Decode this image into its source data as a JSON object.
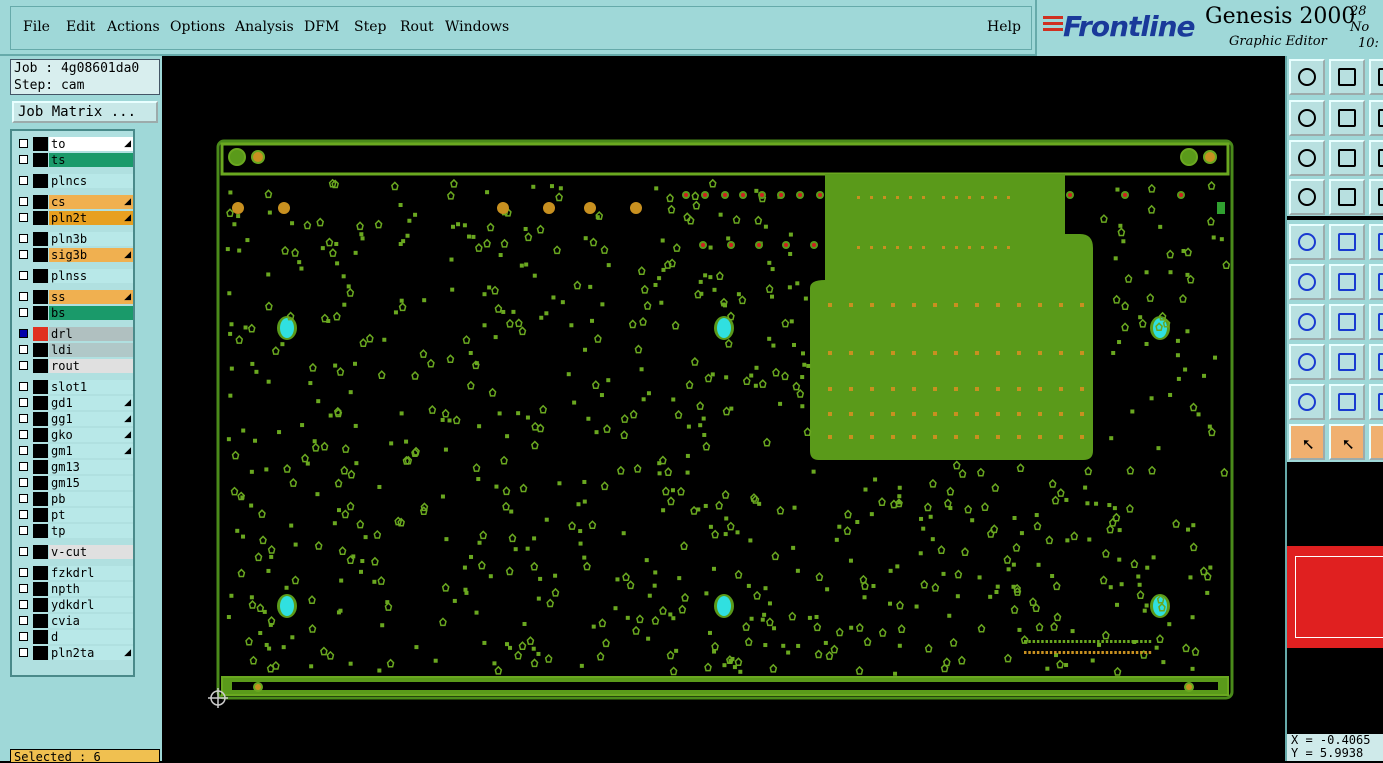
{
  "menu": {
    "items": [
      {
        "label": "File"
      },
      {
        "label": "Edit"
      },
      {
        "label": "Actions"
      },
      {
        "label": "Options"
      },
      {
        "label": "Analysis"
      },
      {
        "label": "DFM"
      },
      {
        "label": "Step"
      },
      {
        "label": "Rout"
      },
      {
        "label": "Windows"
      }
    ],
    "help": "Help"
  },
  "brand": {
    "logo": "Frontline",
    "product": "Genesis 2000",
    "subtitle": "Graphic Editor",
    "date_line1": "28 No",
    "date_line2": "10:"
  },
  "job": {
    "job_line": "Job : 4g08601da0",
    "step_line": "Step: cam",
    "matrix_button": "Job Matrix ..."
  },
  "layers": [
    {
      "name": "to",
      "bg": "#ffffff",
      "edit": true
    },
    {
      "name": "ts",
      "bg": "#1a9a6a",
      "edit": false
    },
    {
      "name": "plncs",
      "bg": "#b8e8e8",
      "edit": false
    },
    {
      "name": "cs",
      "bg": "#f0b050",
      "edit": true
    },
    {
      "name": "pln2t",
      "bg": "#e8a020",
      "edit": true
    },
    {
      "name": "pln3b",
      "bg": "#b8e8e8",
      "edit": false
    },
    {
      "name": "sig3b",
      "bg": "#f0b050",
      "edit": true
    },
    {
      "name": "plnss",
      "bg": "#b8e8e8",
      "edit": false
    },
    {
      "name": "ss",
      "bg": "#f0b050",
      "edit": true
    },
    {
      "name": "bs",
      "bg": "#1a9a6a",
      "edit": false
    },
    {
      "name": "drl",
      "bg": "#b0c0c0",
      "edit": false,
      "active": true
    },
    {
      "name": "ldi",
      "bg": "#b0c8c8",
      "edit": false
    },
    {
      "name": "rout",
      "bg": "#e0e0e0",
      "edit": false
    },
    {
      "name": "slot1",
      "bg": "#b8e8e8",
      "edit": false
    },
    {
      "name": "gd1",
      "bg": "#b8e8e8",
      "edit": true
    },
    {
      "name": "gg1",
      "bg": "#b8e8e8",
      "edit": true
    },
    {
      "name": "gko",
      "bg": "#b8e8e8",
      "edit": true
    },
    {
      "name": "gm1",
      "bg": "#b8e8e8",
      "edit": true
    },
    {
      "name": "gm13",
      "bg": "#b8e8e8",
      "edit": false
    },
    {
      "name": "gm15",
      "bg": "#b8e8e8",
      "edit": false
    },
    {
      "name": "pb",
      "bg": "#b8e8e8",
      "edit": false
    },
    {
      "name": "pt",
      "bg": "#b8e8e8",
      "edit": false
    },
    {
      "name": "tp",
      "bg": "#b8e8e8",
      "edit": false
    },
    {
      "name": "v-cut",
      "bg": "#e0e0e0",
      "edit": false
    },
    {
      "name": "fzkdrl",
      "bg": "#b8e8e8",
      "edit": false
    },
    {
      "name": "npth",
      "bg": "#b8e8e8",
      "edit": false
    },
    {
      "name": "ydkdrl",
      "bg": "#b8e8e8",
      "edit": false
    },
    {
      "name": "cvia",
      "bg": "#b8e8e8",
      "edit": false
    },
    {
      "name": "d",
      "bg": "#b8e8e8",
      "edit": false
    },
    {
      "name": "pln2ta",
      "bg": "#b8e8e8",
      "edit": true
    }
  ],
  "selected_text": "Selected : 6",
  "coords": {
    "x": "X = -0.4065",
    "y": "Y = 5.9938"
  },
  "colors": {
    "board_green": "#5a9a1a",
    "pad_green": "#6aa820",
    "outline_green": "#4a8a1a",
    "hole_cyan": "#30e0e0",
    "pad_orange": "#c89020",
    "panel_teal": "#9fd8d8"
  }
}
